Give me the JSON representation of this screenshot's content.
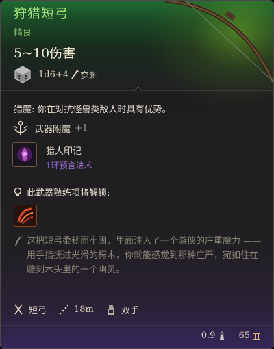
{
  "item": {
    "name": "狩猎短弓",
    "rarity": "精良",
    "damage": "5~10伤害",
    "damage_dice": "1d6+4",
    "damage_type": "穿刺"
  },
  "passive": {
    "text": "猎魔: 你在对抗怪兽类敌人时具有优势。"
  },
  "enchantment": {
    "label": "武器附魔",
    "bonus": "+1"
  },
  "spell": {
    "name": "猎人印记",
    "subtitle": "1环预言法术"
  },
  "proficiency": {
    "label": "此武器熟练项将解锁:"
  },
  "lore": {
    "line1": "这把短弓柔韧而牢固，里面注入了一个游侠的庄重魔力 ——",
    "line2": "用手指抚过光滑的枵木，你就能感觉到那种庄严，宛如住在雕刻木头里的一个幽灵。"
  },
  "stats": {
    "weapon_type": "短弓",
    "range": "18m",
    "handedness": "双手"
  },
  "footer": {
    "weight": "0.9",
    "value": "65"
  },
  "colors": {
    "title": "#a8e07a",
    "rarity": "#8ec46a",
    "spell_school": "#9a6fd0",
    "header_green": "#1f6b33"
  },
  "icons": [
    "dice-icon",
    "piercing-icon",
    "enchant-icon",
    "hunters-mark-icon",
    "lightbulb-icon",
    "proficiency-icon",
    "quill-icon",
    "weapon-type-icon",
    "range-icon",
    "hand-icon",
    "weight-icon",
    "gold-icon",
    "bow-art"
  ]
}
